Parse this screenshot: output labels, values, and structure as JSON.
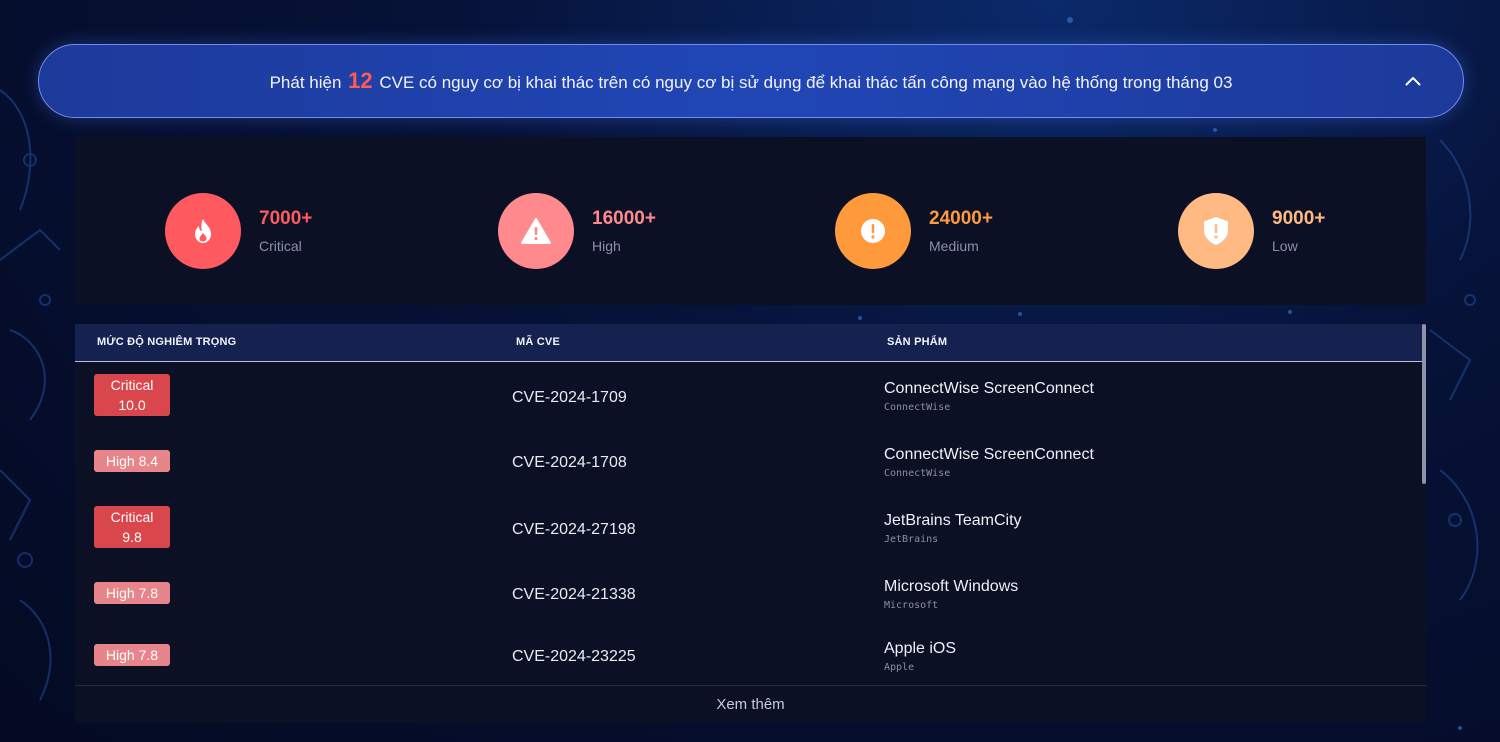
{
  "banner": {
    "prefix": "Phát hiện",
    "count": "12",
    "suffix": "CVE có nguy cơ bị khai thác trên có nguy cơ bị sử dụng để khai thác tấn công mạng vào hệ thống trong tháng 03",
    "collapse_icon": "chevron-up-icon"
  },
  "stats": [
    {
      "value": "7000+",
      "label": "Critical",
      "color": "#ff5a5f",
      "icon": "fire-icon"
    },
    {
      "value": "16000+",
      "label": "High",
      "color": "#ff8a8e",
      "icon": "warning-icon"
    },
    {
      "value": "24000+",
      "label": "Medium",
      "color": "#ff9a3c",
      "icon": "alert-circle-icon"
    },
    {
      "value": "9000+",
      "label": "Low",
      "color": "#ffb983",
      "icon": "shield-alert-icon"
    }
  ],
  "table": {
    "headers": [
      "MỨC ĐỘ NGHIÊM TRỌNG",
      "MÃ CVE",
      "SẢN PHẨM"
    ],
    "rows": [
      {
        "severity_line1": "Critical",
        "severity_line2": "10.0",
        "level": "critical",
        "cve": "CVE-2024-1709",
        "product": "ConnectWise ScreenConnect",
        "vendor": "ConnectWise"
      },
      {
        "severity_line1": "High 8.4",
        "severity_line2": "",
        "level": "high",
        "cve": "CVE-2024-1708",
        "product": "ConnectWise ScreenConnect",
        "vendor": "ConnectWise"
      },
      {
        "severity_line1": "Critical",
        "severity_line2": "9.8",
        "level": "critical",
        "cve": "CVE-2024-27198",
        "product": "JetBrains TeamCity",
        "vendor": "JetBrains"
      },
      {
        "severity_line1": "High 7.8",
        "severity_line2": "",
        "level": "high",
        "cve": "CVE-2024-21338",
        "product": "Microsoft Windows",
        "vendor": "Microsoft"
      },
      {
        "severity_line1": "High 7.8",
        "severity_line2": "",
        "level": "high",
        "cve": "CVE-2024-23225",
        "product": "Apple iOS",
        "vendor": "Apple"
      }
    ],
    "more_label": "Xem thêm"
  },
  "colors": {
    "critical_badge": "#d9474c",
    "high_badge": "#e8858a",
    "banner_count": "#ff5a55"
  }
}
